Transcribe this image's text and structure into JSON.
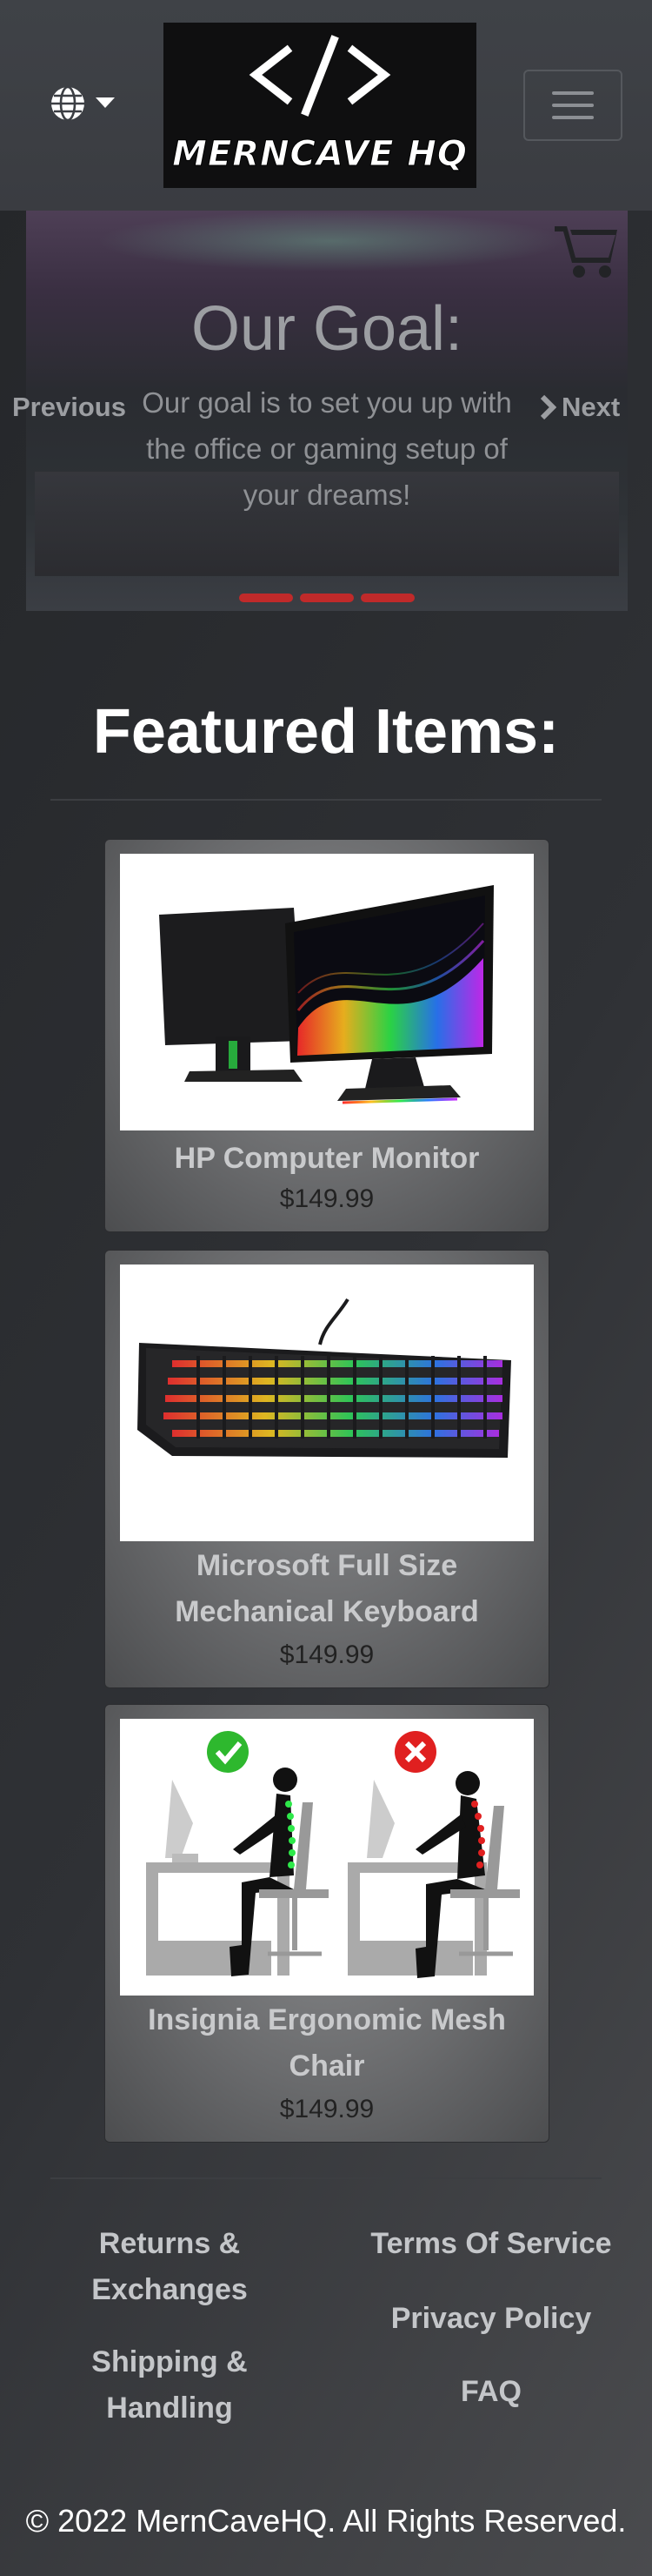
{
  "brand": {
    "logo_text": "MERNCAVE HQ",
    "logo_alt": "MernCave HQ logo"
  },
  "navbar": {
    "language_icon": "globe-icon",
    "dropdown_icon": "caret-down-icon",
    "menu_icon": "hamburger-menu-icon"
  },
  "carousel": {
    "title": "Our Goal:",
    "caption": "Our goal is to set you up with the office or gaming setup of your dreams!",
    "prev_label": "Previous",
    "next_label": "Next",
    "slide_count": 3,
    "cart_icon": "shopping-cart-icon",
    "indicator_color": "#c02a2a"
  },
  "featured": {
    "title": "Featured Items:",
    "items": [
      {
        "name": "HP Computer Monitor",
        "price": "$149.99",
        "image": "monitor"
      },
      {
        "name": "Microsoft Full Size Mechanical Keyboard",
        "price": "$149.99",
        "image": "keyboard"
      },
      {
        "name": "Insignia Ergonomic Mesh Chair",
        "price": "$149.99",
        "image": "posture-chair"
      }
    ]
  },
  "footer": {
    "links_left": [
      "Returns & Exchanges",
      "Shipping & Handling"
    ],
    "links_right": [
      "Terms Of Service",
      "Privacy Policy",
      "FAQ"
    ],
    "copyright": "© 2022 MernCaveHQ. All Rights Reserved."
  }
}
